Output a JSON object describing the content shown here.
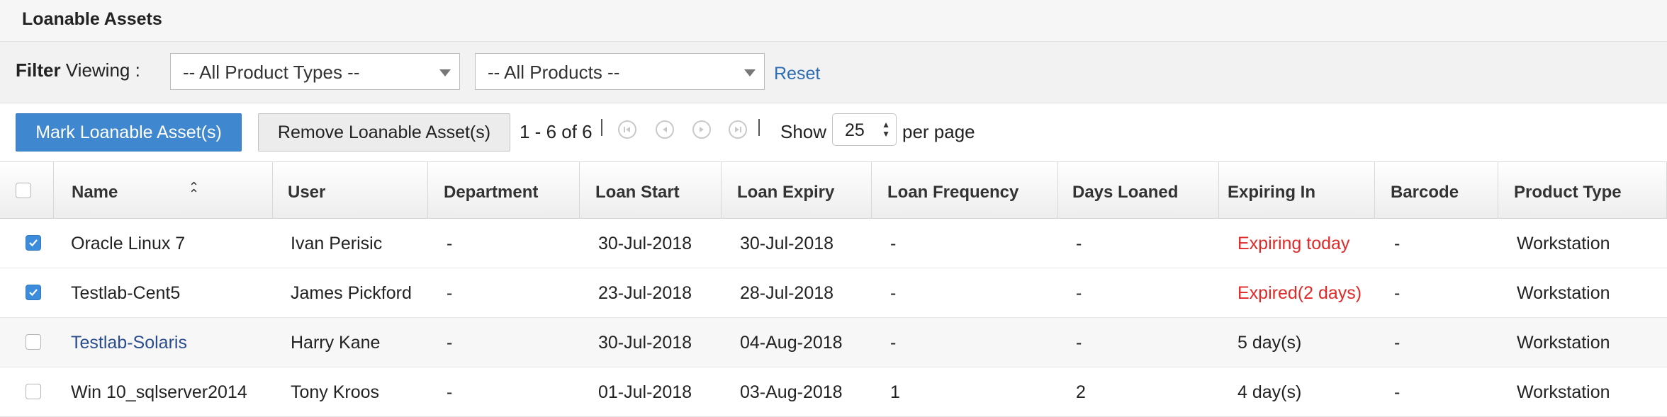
{
  "header": {
    "title": "Loanable Assets"
  },
  "filter": {
    "label_bold": "Filter",
    "label_rest": " Viewing :",
    "product_types": "-- All Product Types --",
    "products": "-- All Products --",
    "reset": "Reset"
  },
  "toolbar": {
    "mark_label": "Mark Loanable Asset(s)",
    "remove_label": "Remove Loanable Asset(s)",
    "range": "1 - 6 of 6",
    "show_label": "Show",
    "per_page_value": "25",
    "per_page_label": "per page"
  },
  "columns": [
    "Name",
    "User",
    "Department",
    "Loan Start",
    "Loan Expiry",
    "Loan Frequency",
    "Days Loaned",
    "Expiring In",
    "Barcode",
    "Product Type"
  ],
  "rows": [
    {
      "checked": true,
      "name": "Oracle Linux 7",
      "user": "Ivan Perisic",
      "department": "-",
      "loan_start": "30-Jul-2018",
      "loan_expiry": "30-Jul-2018",
      "frequency": "-",
      "days": "-",
      "expiring": "Expiring today",
      "expiring_alert": true,
      "barcode": "-",
      "type": "Workstation"
    },
    {
      "checked": true,
      "name": "Testlab-Cent5",
      "user": "James Pickford",
      "department": "-",
      "loan_start": "23-Jul-2018",
      "loan_expiry": "28-Jul-2018",
      "frequency": "-",
      "days": "-",
      "expiring": "Expired(2 days)",
      "expiring_alert": true,
      "barcode": "-",
      "type": "Workstation"
    },
    {
      "checked": false,
      "name": "Testlab-Solaris",
      "user": "Harry Kane",
      "department": "-",
      "loan_start": "30-Jul-2018",
      "loan_expiry": "04-Aug-2018",
      "frequency": "-",
      "days": "-",
      "expiring": "5 day(s)",
      "expiring_alert": false,
      "barcode": "-",
      "type": "Workstation"
    },
    {
      "checked": false,
      "name": "Win 10_sqlserver2014",
      "user": "Tony Kroos",
      "department": "-",
      "loan_start": "01-Jul-2018",
      "loan_expiry": "03-Aug-2018",
      "frequency": "1",
      "days": "2",
      "expiring": "4 day(s)",
      "expiring_alert": false,
      "barcode": "-",
      "type": "Workstation"
    }
  ],
  "colors": {
    "accent": "#3f87cf",
    "alert": "#e02a2a",
    "link": "#2c6db3"
  }
}
